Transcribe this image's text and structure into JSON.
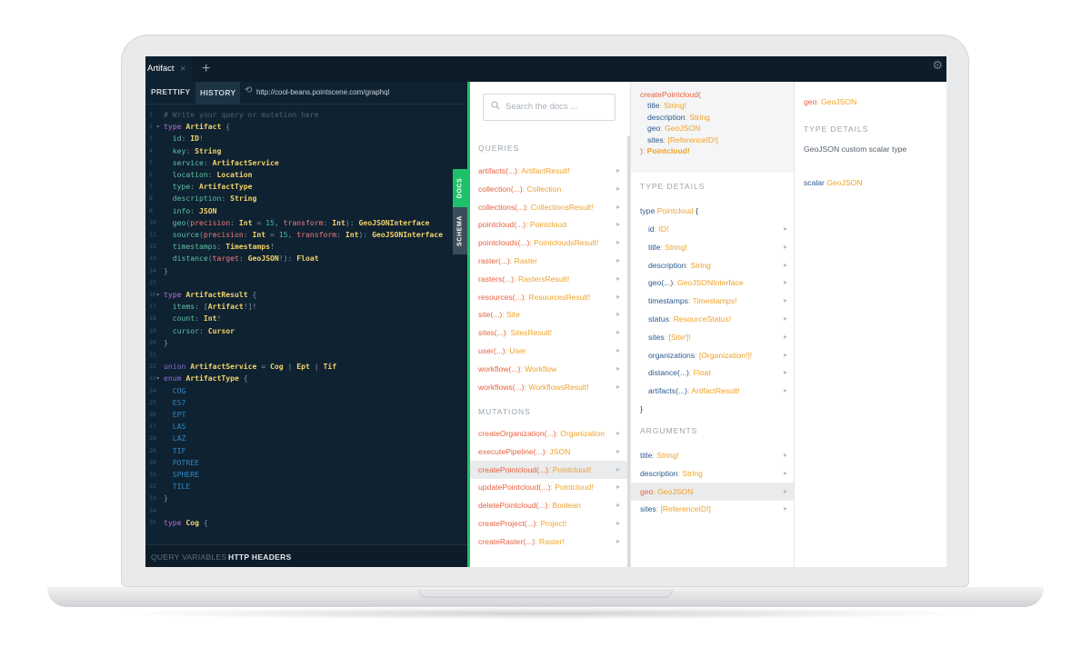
{
  "tabs": [
    {
      "label": "Artifact",
      "close": "×"
    }
  ],
  "add_tab": "+",
  "toolbar": {
    "prettify": "PRETTIFY",
    "history": "HISTORY",
    "url": "http://cool-beans.pointscene.com/graphql"
  },
  "editor": {
    "lines": [
      {
        "n": "1",
        "fold": "",
        "tokens": [
          [
            "c-cm",
            "# Write your query or mutation here"
          ]
        ]
      },
      {
        "n": "2",
        "fold": "▾",
        "tokens": [
          [
            "c-kw",
            "type "
          ],
          [
            "c-ty",
            "Artifact"
          ],
          [
            "c-pu",
            " {"
          ]
        ]
      },
      {
        "n": "3",
        "fold": "",
        "tokens": [
          [
            "c-fd",
            "  id"
          ],
          [
            "c-pu",
            ": "
          ],
          [
            "c-ty",
            "ID"
          ],
          [
            "c-pu",
            "!"
          ]
        ]
      },
      {
        "n": "4",
        "fold": "",
        "tokens": [
          [
            "c-fd",
            "  key"
          ],
          [
            "c-pu",
            ": "
          ],
          [
            "c-ty",
            "String"
          ]
        ]
      },
      {
        "n": "5",
        "fold": "",
        "tokens": [
          [
            "c-fd",
            "  service"
          ],
          [
            "c-pu",
            ": "
          ],
          [
            "c-ty",
            "ArtifactService"
          ]
        ]
      },
      {
        "n": "6",
        "fold": "",
        "tokens": [
          [
            "c-fd",
            "  location"
          ],
          [
            "c-pu",
            ": "
          ],
          [
            "c-ty",
            "Location"
          ]
        ]
      },
      {
        "n": "7",
        "fold": "",
        "tokens": [
          [
            "c-fd",
            "  type"
          ],
          [
            "c-pu",
            ": "
          ],
          [
            "c-ty",
            "ArtifactType"
          ]
        ]
      },
      {
        "n": "8",
        "fold": "",
        "tokens": [
          [
            "c-fd",
            "  description"
          ],
          [
            "c-pu",
            ": "
          ],
          [
            "c-ty",
            "String"
          ]
        ]
      },
      {
        "n": "9",
        "fold": "",
        "tokens": [
          [
            "c-fd",
            "  info"
          ],
          [
            "c-pu",
            ": "
          ],
          [
            "c-ty",
            "JSON"
          ]
        ]
      },
      {
        "n": "10",
        "fold": "",
        "tokens": [
          [
            "c-fd",
            "  geo"
          ],
          [
            "c-pu",
            "("
          ],
          [
            "c-ar",
            "precision"
          ],
          [
            "c-pu",
            ": "
          ],
          [
            "c-ty",
            "Int"
          ],
          [
            "c-pu",
            " = "
          ],
          [
            "c-nm",
            "15"
          ],
          [
            "c-pu",
            ", "
          ],
          [
            "c-ar",
            "transform"
          ],
          [
            "c-pu",
            ": "
          ],
          [
            "c-ty",
            "Int"
          ],
          [
            "c-pu",
            "): "
          ],
          [
            "c-ty",
            "GeoJSONInterface"
          ]
        ]
      },
      {
        "n": "11",
        "fold": "",
        "tokens": [
          [
            "c-fd",
            "  source"
          ],
          [
            "c-pu",
            "("
          ],
          [
            "c-ar",
            "precision"
          ],
          [
            "c-pu",
            ": "
          ],
          [
            "c-ty",
            "Int"
          ],
          [
            "c-pu",
            " = "
          ],
          [
            "c-nm",
            "15"
          ],
          [
            "c-pu",
            ", "
          ],
          [
            "c-ar",
            "transform"
          ],
          [
            "c-pu",
            ": "
          ],
          [
            "c-ty",
            "Int"
          ],
          [
            "c-pu",
            "): "
          ],
          [
            "c-ty",
            "GeoJSONInterface"
          ]
        ]
      },
      {
        "n": "12",
        "fold": "",
        "tokens": [
          [
            "c-fd",
            "  timestamps"
          ],
          [
            "c-pu",
            ": "
          ],
          [
            "c-ty",
            "Timestamps"
          ],
          [
            "c-pu",
            "!"
          ]
        ]
      },
      {
        "n": "13",
        "fold": "",
        "tokens": [
          [
            "c-fd",
            "  distance"
          ],
          [
            "c-pu",
            "("
          ],
          [
            "c-ar",
            "target"
          ],
          [
            "c-pu",
            ": "
          ],
          [
            "c-ty",
            "GeoJSON"
          ],
          [
            "c-pu",
            "!): "
          ],
          [
            "c-ty",
            "Float"
          ]
        ]
      },
      {
        "n": "14",
        "fold": "",
        "tokens": [
          [
            "c-pu",
            "}"
          ]
        ]
      },
      {
        "n": "15",
        "fold": "",
        "tokens": []
      },
      {
        "n": "16",
        "fold": "▾",
        "tokens": [
          [
            "c-kw",
            "type "
          ],
          [
            "c-ty",
            "ArtifactResult"
          ],
          [
            "c-pu",
            " {"
          ]
        ]
      },
      {
        "n": "17",
        "fold": "",
        "tokens": [
          [
            "c-fd",
            "  items"
          ],
          [
            "c-pu",
            ": ["
          ],
          [
            "c-ty",
            "Artifact"
          ],
          [
            "c-pu",
            "!]!"
          ]
        ]
      },
      {
        "n": "18",
        "fold": "",
        "tokens": [
          [
            "c-fd",
            "  count"
          ],
          [
            "c-pu",
            ": "
          ],
          [
            "c-ty",
            "Int"
          ],
          [
            "c-pu",
            "!"
          ]
        ]
      },
      {
        "n": "19",
        "fold": "",
        "tokens": [
          [
            "c-fd",
            "  cursor"
          ],
          [
            "c-pu",
            ": "
          ],
          [
            "c-ty",
            "Cursor"
          ]
        ]
      },
      {
        "n": "20",
        "fold": "",
        "tokens": [
          [
            "c-pu",
            "}"
          ]
        ]
      },
      {
        "n": "21",
        "fold": "",
        "tokens": []
      },
      {
        "n": "22",
        "fold": "",
        "tokens": [
          [
            "c-kw2",
            "union "
          ],
          [
            "c-ty",
            "ArtifactService"
          ],
          [
            "c-pu",
            " = "
          ],
          [
            "c-ty",
            "Cog"
          ],
          [
            "c-pu",
            " | "
          ],
          [
            "c-ty",
            "Ept"
          ],
          [
            "c-pu",
            " | "
          ],
          [
            "c-ty",
            "Tif"
          ]
        ]
      },
      {
        "n": "23",
        "fold": "▾",
        "tokens": [
          [
            "c-kw2",
            "enum "
          ],
          [
            "c-ty",
            "ArtifactType"
          ],
          [
            "c-pu",
            " {"
          ]
        ]
      },
      {
        "n": "24",
        "fold": "",
        "tokens": [
          [
            "c-ev",
            "  COG"
          ]
        ]
      },
      {
        "n": "25",
        "fold": "",
        "tokens": [
          [
            "c-ev",
            "  E57"
          ]
        ]
      },
      {
        "n": "26",
        "fold": "",
        "tokens": [
          [
            "c-ev",
            "  EPT"
          ]
        ]
      },
      {
        "n": "27",
        "fold": "",
        "tokens": [
          [
            "c-ev",
            "  LAS"
          ]
        ]
      },
      {
        "n": "28",
        "fold": "",
        "tokens": [
          [
            "c-ev",
            "  LAZ"
          ]
        ]
      },
      {
        "n": "29",
        "fold": "",
        "tokens": [
          [
            "c-ev",
            "  TIF"
          ]
        ]
      },
      {
        "n": "30",
        "fold": "",
        "tokens": [
          [
            "c-ev",
            "  POTREE"
          ]
        ]
      },
      {
        "n": "31",
        "fold": "",
        "tokens": [
          [
            "c-ev",
            "  SPHERE"
          ]
        ]
      },
      {
        "n": "32",
        "fold": "",
        "tokens": [
          [
            "c-ev",
            "  TILE"
          ]
        ]
      },
      {
        "n": "33",
        "fold": "",
        "tokens": [
          [
            "c-pu",
            "}"
          ]
        ]
      },
      {
        "n": "34",
        "fold": "",
        "tokens": []
      },
      {
        "n": "35",
        "fold": "",
        "tokens": [
          [
            "c-kw",
            "type "
          ],
          [
            "c-ty",
            "Cog"
          ],
          [
            "c-pu",
            " {"
          ]
        ]
      }
    ]
  },
  "bottom_bar": {
    "query_variables": "QUERY VARIABLES",
    "http_headers": "HTTP HEADERS"
  },
  "side_tabs": {
    "docs": "DOCS",
    "schema": "SCHEMA"
  },
  "docs": {
    "search_placeholder": "Search the docs ...",
    "queries_title": "QUERIES",
    "queries": [
      {
        "name": "artifacts",
        "args": "(...)",
        "type": ": ArtifactResult!"
      },
      {
        "name": "collection",
        "args": "(...)",
        "type": ": Collection"
      },
      {
        "name": "collections",
        "args": "(...)",
        "type": ": CollectionsResult!"
      },
      {
        "name": "pointcloud",
        "args": "(...)",
        "type": ": Pointcloud"
      },
      {
        "name": "pointclouds",
        "args": "(...)",
        "type": ": PointcloudsResult!"
      },
      {
        "name": "raster",
        "args": "(...)",
        "type": ": Raster"
      },
      {
        "name": "rasters",
        "args": "(...)",
        "type": ": RastersResult!"
      },
      {
        "name": "resources",
        "args": "(...)",
        "type": ": ResourcesResult!"
      },
      {
        "name": "site",
        "args": "(...)",
        "type": ": Site"
      },
      {
        "name": "sites",
        "args": "(...)",
        "type": ": SitesResult!"
      },
      {
        "name": "user",
        "args": "(...)",
        "type": ": User"
      },
      {
        "name": "workflow",
        "args": "(...)",
        "type": ": Workflow"
      },
      {
        "name": "workflows",
        "args": "(...)",
        "type": ": WorkflowsResult!"
      }
    ],
    "mutations_title": "MUTATIONS",
    "mutations": [
      {
        "name": "createOrganization",
        "args": "(...)",
        "type": ": Organization"
      },
      {
        "name": "executePipeline",
        "args": "(...)",
        "type": ": JSON"
      },
      {
        "name": "createPointcloud",
        "args": "(...)",
        "type": ": Pointcloud!",
        "active": true
      },
      {
        "name": "updatePointcloud",
        "args": "(...)",
        "type": ": Pointcloud!"
      },
      {
        "name": "deletePointcloud",
        "args": "(...)",
        "type": ": Boolean"
      },
      {
        "name": "createProject",
        "args": "(...)",
        "type": ": Project!"
      },
      {
        "name": "createRaster",
        "args": "(...)",
        "type": ": Raster!"
      }
    ],
    "chevron": "▸"
  },
  "field_detail": {
    "signature_name": "createPointcloud(",
    "signature_args": [
      {
        "name": "title",
        "type": ": String!"
      },
      {
        "name": "description",
        "type": ": String"
      },
      {
        "name": "geo",
        "type": ": GeoJSON"
      },
      {
        "name": "sites",
        "type": ": [ReferenceID!]"
      }
    ],
    "signature_return_close": "): ",
    "signature_return": "Pointcloud!",
    "type_details_title": "TYPE DETAILS",
    "type_open_kw": "type ",
    "type_open_name": "Pointcloud",
    "type_open_brace": " {",
    "type_fields": [
      {
        "name": "id",
        "args": "",
        "type": ": ID!"
      },
      {
        "name": "title",
        "args": "",
        "type": ": String!"
      },
      {
        "name": "description",
        "args": "",
        "type": ": String"
      },
      {
        "name": "geo",
        "args": "(...)",
        "type": ": GeoJSONInterface"
      },
      {
        "name": "timestamps",
        "args": "",
        "type": ": Timestamps!"
      },
      {
        "name": "status",
        "args": "",
        "type": ": ResourceStatus!"
      },
      {
        "name": "sites",
        "args": "",
        "type": ": [Site!]!"
      },
      {
        "name": "organizations",
        "args": "",
        "type": ": [Organization!]!"
      },
      {
        "name": "distance",
        "args": "(...)",
        "type": ": Float"
      },
      {
        "name": "artifacts",
        "args": "(...)",
        "type": ": ArtifactResult!"
      }
    ],
    "type_close": "}",
    "arguments_title": "ARGUMENTS",
    "arguments": [
      {
        "name": "title",
        "type": ": String!"
      },
      {
        "name": "description",
        "type": ": String"
      },
      {
        "name": "geo",
        "type": ": GeoJSON",
        "active": true
      },
      {
        "name": "sites",
        "type": ": [ReferenceID!]"
      }
    ]
  },
  "scalar_detail": {
    "head_name": "geo",
    "head_type": ": GeoJSON",
    "type_details_title": "TYPE DETAILS",
    "description": "GeoJSON custom scalar type",
    "scalar_kw": "scalar ",
    "scalar_name": "GeoJSON"
  },
  "colors": {
    "accent_green": "#1ec069",
    "editor_bg": "#0f2231",
    "field_red": "#e8623f",
    "type_orange": "#f0a22a",
    "arg_blue": "#2a5a8f"
  },
  "icons": [
    "close-icon",
    "plus-icon",
    "gear-icon",
    "history-icon",
    "search-icon",
    "chevron-right-icon",
    "fold-arrow-icon"
  ]
}
